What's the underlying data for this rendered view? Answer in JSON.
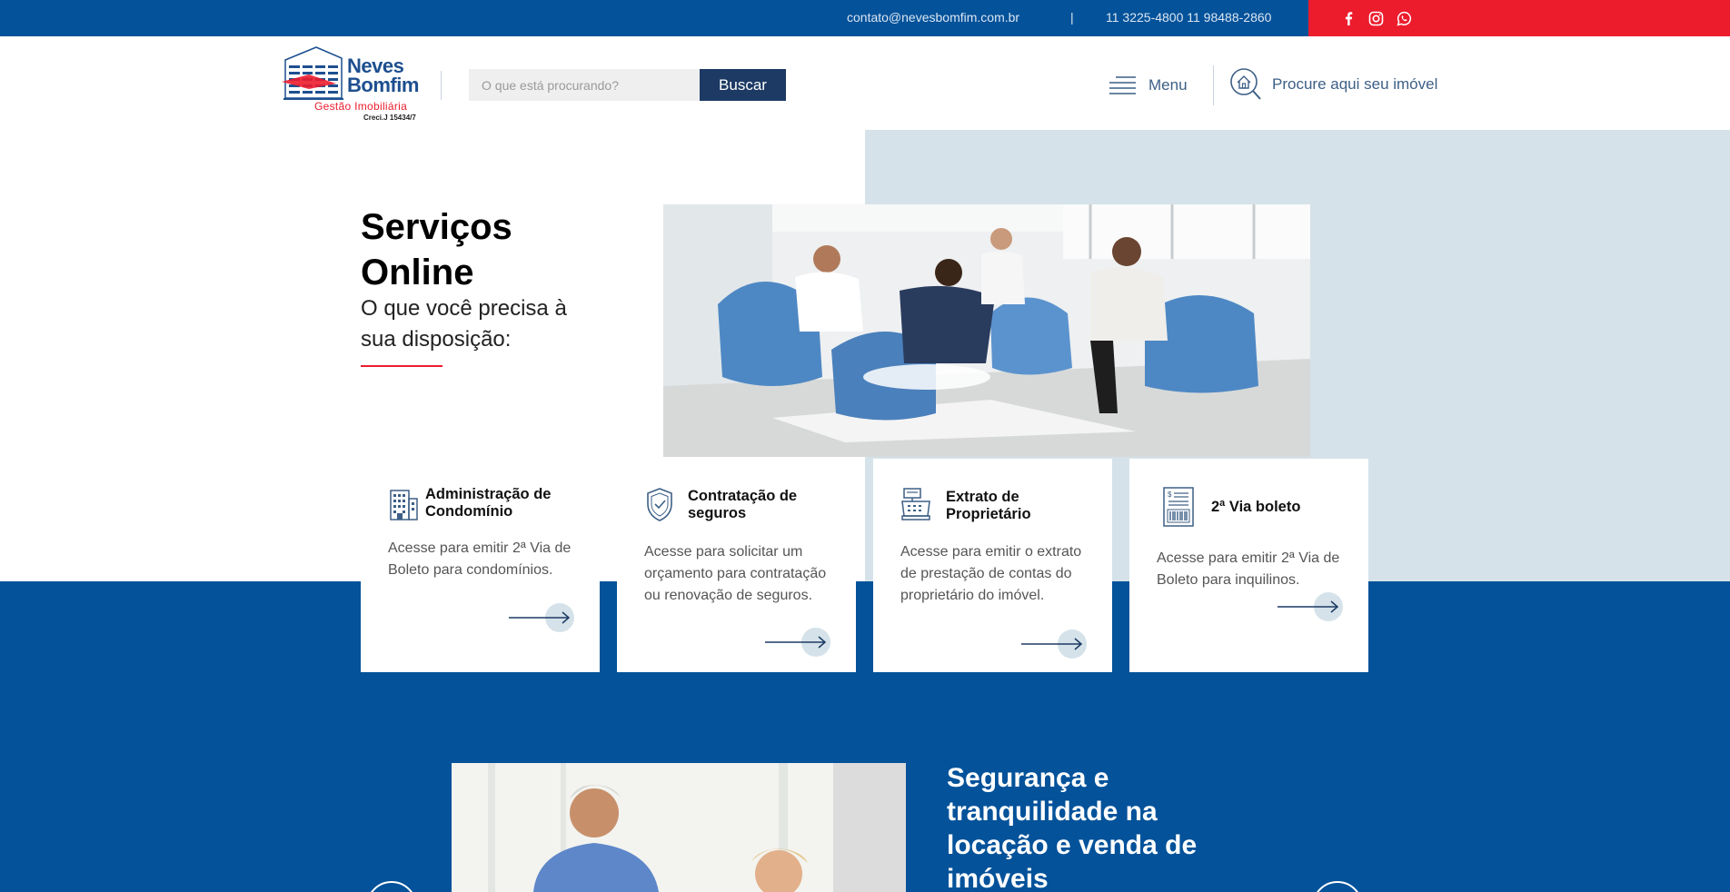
{
  "topbar": {
    "email": "contato@nevesbomfim.com.br",
    "separator": "|",
    "phones": "11 3225-4800 11 98488-2860",
    "social": [
      "facebook-icon",
      "instagram-icon",
      "whatsapp-icon"
    ]
  },
  "header": {
    "logo": {
      "name_line1": "Neves",
      "name_line2": "Bomfim",
      "subtitle": "Gestão Imobiliária",
      "creci": "Creci.J 15434/7"
    },
    "search": {
      "placeholder": "O que está procurando?",
      "value": "",
      "button_label": "Buscar"
    },
    "menu_label": "Menu",
    "property_search_label": "Procure aqui seu imóvel"
  },
  "hero": {
    "title": "Serviços Online",
    "subtitle": "O que você precisa à sua disposição:"
  },
  "cards": [
    {
      "icon": "building-icon",
      "title": "Administração de Condomínio",
      "description": "Acesse para emitir 2ª Via de Boleto para condomínios."
    },
    {
      "icon": "shield-check-icon",
      "title": "Contratação de seguros",
      "description": "Acesse para solicitar um orçamento para contratação ou renovação de seguros."
    },
    {
      "icon": "cash-register-icon",
      "title": "Extrato de Proprietário",
      "description": "Acesse para emitir o extrato de prestação de contas do proprietário do imóvel."
    },
    {
      "icon": "invoice-barcode-icon",
      "title": "2ª Via boleto",
      "description": "Acesse para emitir 2ª Via de Boleto para inquilinos."
    }
  ],
  "bottom": {
    "title": "Segurança e tranquilidade na locação e venda de imóveis"
  },
  "colors": {
    "primary_blue": "#03529a",
    "accent_red": "#ec1c2d",
    "navy": "#1c3a64",
    "light_panel": "#d5e2e9"
  }
}
